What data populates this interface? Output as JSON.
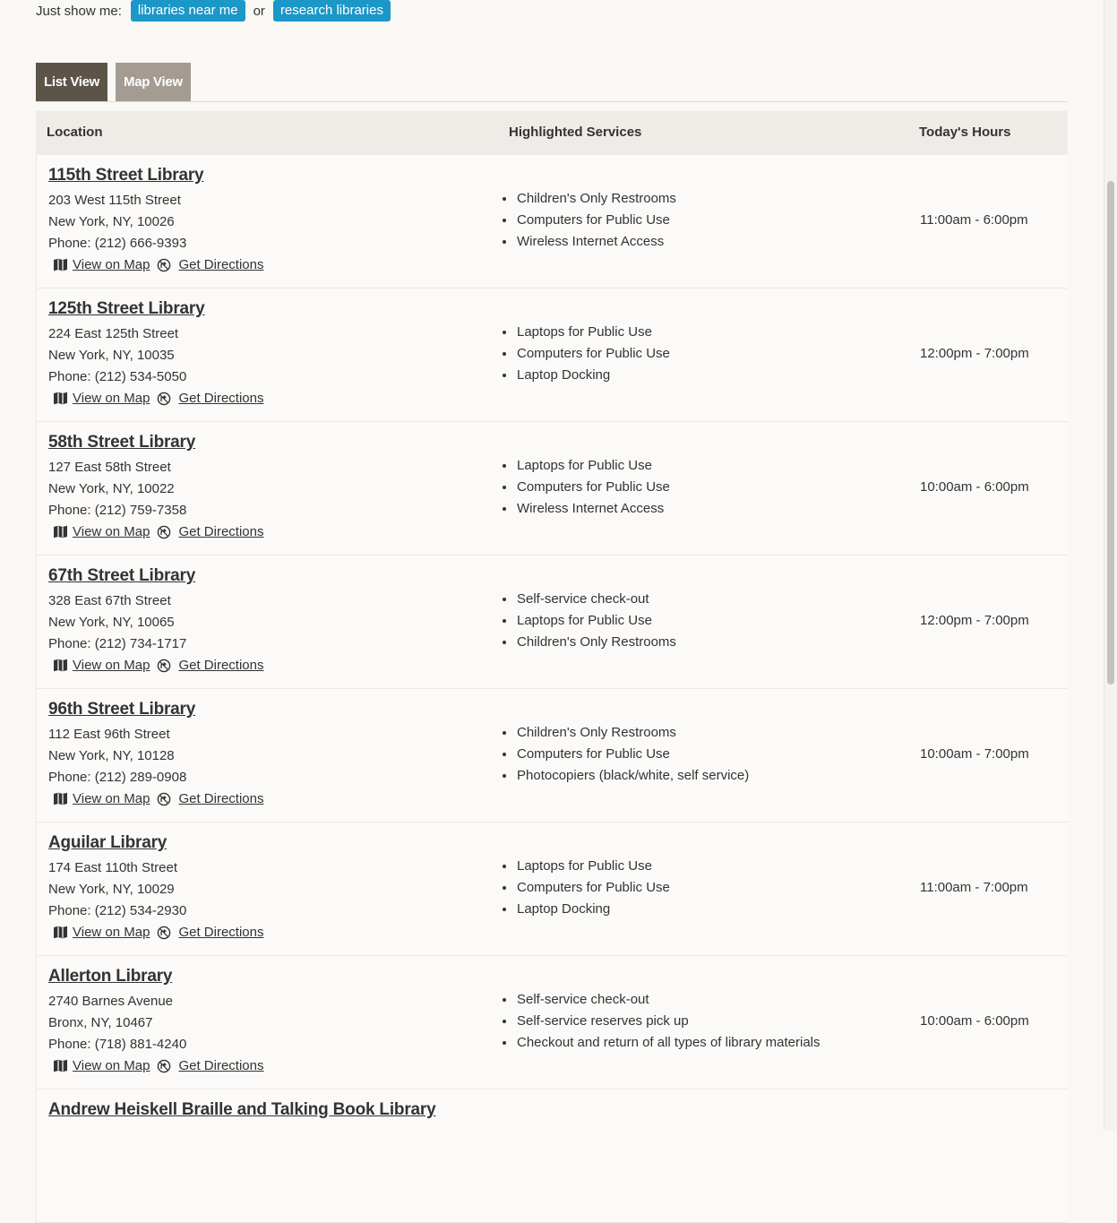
{
  "filter": {
    "lead": "Just show me:",
    "near_label": "libraries near me",
    "or_label": "or",
    "research_label": "research libraries"
  },
  "tabs": {
    "list_label": "List View",
    "map_label": "Map View"
  },
  "table": {
    "col_location": "Location",
    "col_services": "Highlighted Services",
    "col_hours": "Today's Hours"
  },
  "link_labels": {
    "map": "View on Map",
    "directions": "Get Directions"
  },
  "icons": {
    "map": "map-icon",
    "directions": "directions-icon"
  },
  "colors": {
    "pill": "#1b97c8",
    "tab_active": "#5d5449",
    "tab_inactive": "#a49b92"
  },
  "libraries": [
    {
      "name": "115th Street Library",
      "street": "203 West 115th Street",
      "city": "New York, NY, 10026",
      "phone": "Phone: (212) 666-9393",
      "services": [
        "Children's Only Restrooms",
        "Computers for Public Use",
        "Wireless Internet Access"
      ],
      "hours": "11:00am - 6:00pm"
    },
    {
      "name": "125th Street Library",
      "street": "224 East 125th Street",
      "city": "New York, NY, 10035",
      "phone": "Phone: (212) 534-5050",
      "services": [
        "Laptops for Public Use",
        "Computers for Public Use",
        "Laptop Docking"
      ],
      "hours": "12:00pm - 7:00pm"
    },
    {
      "name": "58th Street Library",
      "street": "127 East 58th Street",
      "city": "New York, NY, 10022",
      "phone": "Phone: (212) 759-7358",
      "services": [
        "Laptops for Public Use",
        "Computers for Public Use",
        "Wireless Internet Access"
      ],
      "hours": "10:00am - 6:00pm"
    },
    {
      "name": "67th Street Library",
      "street": "328 East 67th Street",
      "city": "New York, NY, 10065",
      "phone": "Phone: (212) 734-1717",
      "services": [
        "Self-service check-out",
        "Laptops for Public Use",
        "Children's Only Restrooms"
      ],
      "hours": "12:00pm - 7:00pm"
    },
    {
      "name": "96th Street Library",
      "street": "112 East 96th Street",
      "city": "New York, NY, 10128",
      "phone": "Phone: (212) 289-0908",
      "services": [
        "Children's Only Restrooms",
        "Computers for Public Use",
        "Photocopiers (black/white, self service)"
      ],
      "hours": "10:00am - 7:00pm"
    },
    {
      "name": "Aguilar Library",
      "street": "174 East 110th Street",
      "city": "New York, NY, 10029",
      "phone": "Phone: (212) 534-2930",
      "services": [
        "Laptops for Public Use",
        "Computers for Public Use",
        "Laptop Docking"
      ],
      "hours": "11:00am - 7:00pm"
    },
    {
      "name": "Allerton Library",
      "street": "2740 Barnes Avenue",
      "city": "Bronx, NY, 10467",
      "phone": "Phone: (718) 881-4240",
      "services": [
        "Self-service check-out",
        "Self-service reserves pick up",
        "Checkout and return of all types of library materials"
      ],
      "hours": "10:00am - 6:00pm"
    },
    {
      "name": "Andrew Heiskell Braille and Talking Book Library",
      "street": "",
      "city": "",
      "phone": "",
      "services": [],
      "hours": ""
    }
  ]
}
